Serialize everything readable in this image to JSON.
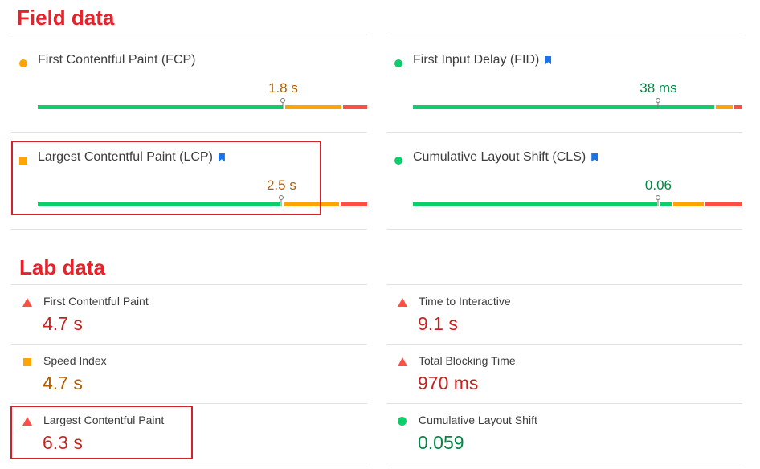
{
  "field_data": {
    "title": "Field data",
    "metrics": [
      {
        "name": "First Contentful Paint (FCP)",
        "value": "1.8 s",
        "status": "average",
        "bookmark": false,
        "marker_fraction": 0.745
      },
      {
        "name": "First Input Delay (FID)",
        "value": "38 ms",
        "status": "good",
        "bookmark": true,
        "marker_fraction": 0.745
      },
      {
        "name": "Largest Contentful Paint (LCP)",
        "value": "2.5 s",
        "status": "average",
        "bookmark": true,
        "marker_fraction": 0.74
      },
      {
        "name": "Cumulative Layout Shift (CLS)",
        "value": "0.06",
        "status": "good",
        "bookmark": true,
        "marker_fraction": 0.745
      }
    ]
  },
  "lab_data": {
    "title": "Lab data",
    "metrics": [
      {
        "name": "First Contentful Paint",
        "value": "4.7 s",
        "status": "poor"
      },
      {
        "name": "Time to Interactive",
        "value": "9.1 s",
        "status": "poor"
      },
      {
        "name": "Speed Index",
        "value": "4.7 s",
        "status": "average"
      },
      {
        "name": "Total Blocking Time",
        "value": "970 ms",
        "status": "poor"
      },
      {
        "name": "Largest Contentful Paint",
        "value": "6.3 s",
        "status": "poor"
      },
      {
        "name": "Cumulative Layout Shift",
        "value": "0.059",
        "status": "good"
      }
    ]
  },
  "colors": {
    "good": "#0cce6b",
    "average": "#ffa400",
    "poor": "#ff4e42",
    "good_text": "#018642",
    "average_text": "#b35c00",
    "poor_text": "#c7221f",
    "highlight": "#d2232a",
    "bookmark": "#1a73e8"
  }
}
